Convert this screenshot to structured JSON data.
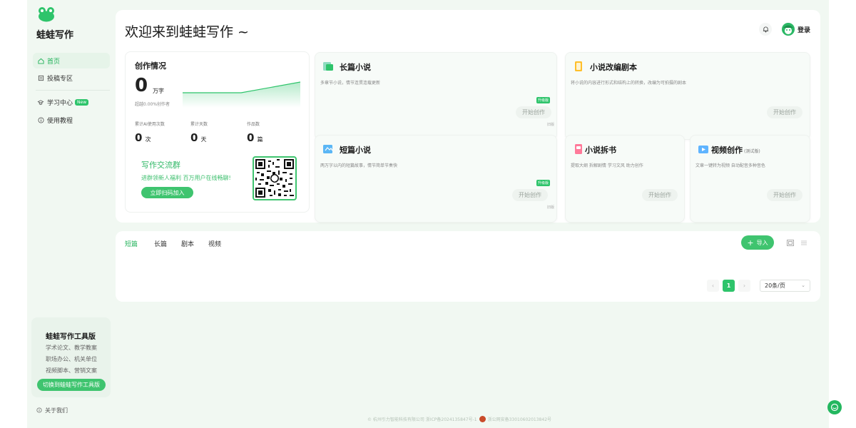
{
  "brand": {
    "name": "蛙蛙写作"
  },
  "sidebar": {
    "items": [
      {
        "label": "首页",
        "icon": "home-icon",
        "active": true
      },
      {
        "label": "投稿专区",
        "icon": "submit-icon",
        "active": false
      },
      {
        "label": "学习中心",
        "icon": "graduation-cap-icon",
        "badge": "New",
        "active": false
      },
      {
        "label": "使用教程",
        "icon": "info-icon",
        "active": false
      }
    ],
    "tool": {
      "title": "蛙蛙写作工具版",
      "lines": [
        "学术论文、教学教案",
        "职场办公、机关单位",
        "视频脚本、营销文案"
      ],
      "button": "切换到蛙蛙写作工具版"
    },
    "about": "关于我们"
  },
  "header": {
    "welcome": "欢迎来到蛙蛙写作 ~",
    "login": "登录"
  },
  "stats": {
    "title": "创作情况",
    "words_value": "0",
    "words_unit": "万字",
    "beat": "超越0.00%创作者",
    "items": [
      {
        "label": "累计AI使用次数",
        "value": "0",
        "unit": "次"
      },
      {
        "label": "累计天数",
        "value": "0",
        "unit": "天"
      },
      {
        "label": "作品数",
        "value": "0",
        "unit": "篇"
      }
    ],
    "group_title": "写作交流群",
    "group_sub": "进群领新人福利 百万用户在线畅聊!",
    "group_button": "立即扫码加入"
  },
  "features": [
    {
      "title": "长篇小说",
      "desc": "多章节小说，情节连贯连载更新",
      "button": "开始创作",
      "tag": "升级版",
      "note": "旧版"
    },
    {
      "title": "小说改编剧本",
      "desc": "将小说的内容进行形式和结构上的转换，改编为可拍摄的剧本",
      "button": "开始创作"
    },
    {
      "title": "短篇小说",
      "desc": "两万字以内的短篇故事，情节简单节奏快",
      "button": "开始创作",
      "tag": "升级版",
      "note": "旧版"
    },
    {
      "title": "小说拆书",
      "desc": "提取大纲 拆解剧情 学习文风 助力创作",
      "button": "开始创作"
    },
    {
      "title": "视频创作",
      "subtitle": "(测试版)",
      "desc": "文章一键转为视频 自动配音多种音色",
      "button": "开始创作"
    }
  ],
  "works": {
    "tabs": [
      "短篇",
      "长篇",
      "剧本",
      "视频"
    ],
    "active_tab": 0,
    "import_label": "导入",
    "pager": {
      "prev": "‹",
      "current": "1",
      "next": "›",
      "page_size": "20条/页"
    }
  },
  "footer": {
    "copyright": "© 杭州引力智能科技有限公司 浙ICP备2024135847号-1",
    "police": "浙公网安备33010602013842号"
  },
  "colors": {
    "accent": "#2ec46b",
    "bg": "#f1f8f2"
  }
}
